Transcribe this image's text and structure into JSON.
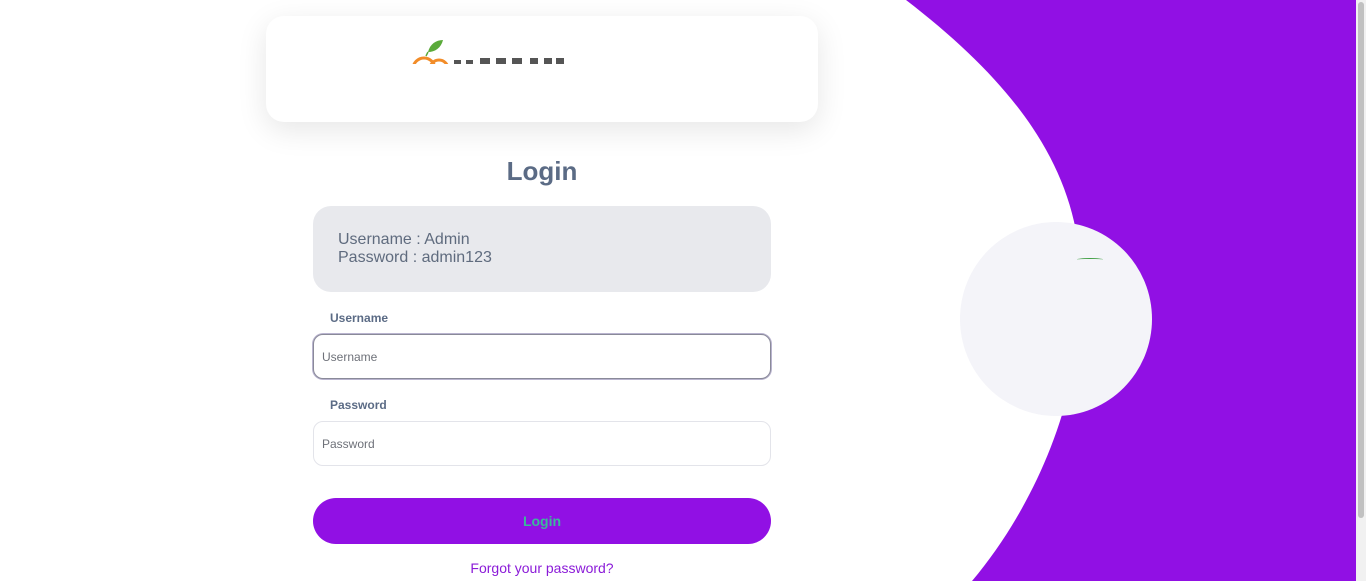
{
  "login": {
    "title": "Login",
    "hint": {
      "username_line": "Username : Admin",
      "password_line": "Password : admin123"
    },
    "username": {
      "label": "Username",
      "placeholder": "Username",
      "value": ""
    },
    "password": {
      "label": "Password",
      "placeholder": "Password",
      "value": ""
    },
    "submit_label": "Login",
    "forgot_link": "Forgot your password?"
  },
  "theme": {
    "accent": "#9110e4",
    "button_text": "#3bb89a",
    "title_text": "#5b6b85",
    "hint_bg": "#e8e9ed"
  },
  "icons": {
    "logo": "orange-logo-icon",
    "decorative_leaf": "leaf-icon"
  }
}
